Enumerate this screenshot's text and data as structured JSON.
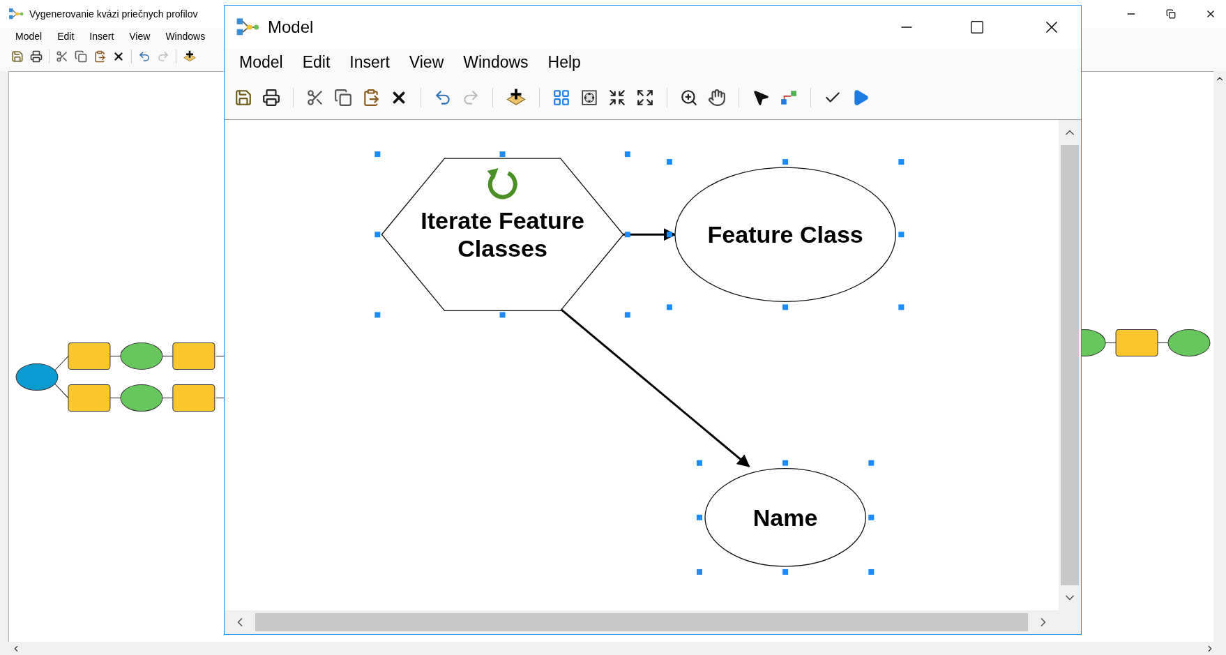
{
  "background_window": {
    "title": "Vygenerovanie kvázi priečnych profilov",
    "menus": [
      "Model",
      "Edit",
      "Insert",
      "View",
      "Windows"
    ]
  },
  "model_window": {
    "title": "Model",
    "menus": [
      "Model",
      "Edit",
      "Insert",
      "View",
      "Windows",
      "Help"
    ],
    "nodes": [
      {
        "kind": "iterator",
        "label": "Iterate Feature Classes",
        "selected": true
      },
      {
        "kind": "variable",
        "label": "Feature Class",
        "selected": true
      },
      {
        "kind": "variable",
        "label": "Name",
        "selected": true
      }
    ]
  }
}
